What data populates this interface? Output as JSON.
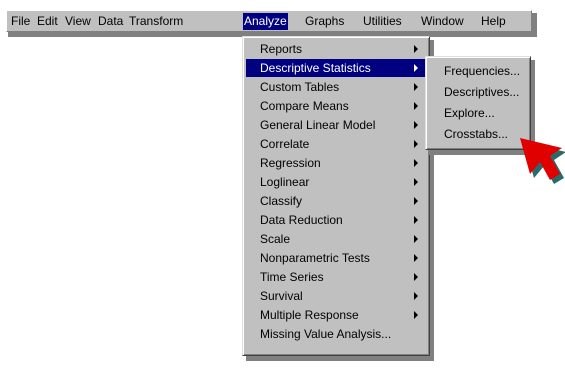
{
  "menubar": {
    "items": [
      "File",
      "Edit",
      "View",
      "Data",
      "Transform",
      "Analyze",
      "Graphs",
      "Utilities",
      "Window",
      "Help"
    ],
    "active": "Analyze"
  },
  "analyze_menu": {
    "items": [
      {
        "label": "Reports",
        "submenu": true
      },
      {
        "label": "Descriptive Statistics",
        "submenu": true,
        "highlighted": true
      },
      {
        "label": "Custom Tables",
        "submenu": true
      },
      {
        "label": "Compare Means",
        "submenu": true
      },
      {
        "label": "General Linear Model",
        "submenu": true
      },
      {
        "label": "Correlate",
        "submenu": true
      },
      {
        "label": "Regression",
        "submenu": true
      },
      {
        "label": "Loglinear",
        "submenu": true
      },
      {
        "label": "Classify",
        "submenu": true
      },
      {
        "label": "Data Reduction",
        "submenu": true
      },
      {
        "label": "Scale",
        "submenu": true
      },
      {
        "label": "Nonparametric Tests",
        "submenu": true
      },
      {
        "label": "Time Series",
        "submenu": true
      },
      {
        "label": "Survival",
        "submenu": true
      },
      {
        "label": "Multiple Response",
        "submenu": true
      },
      {
        "label": "Missing Value Analysis...",
        "submenu": false
      }
    ]
  },
  "descriptive_submenu": {
    "items": [
      "Frequencies...",
      "Descriptives...",
      "Explore...",
      "Crosstabs..."
    ]
  },
  "colors": {
    "menu_bg": "#c0c0c0",
    "highlight": "#000080",
    "cursor_fill": "#e00000",
    "cursor_shadow": "#2a6a6a"
  }
}
